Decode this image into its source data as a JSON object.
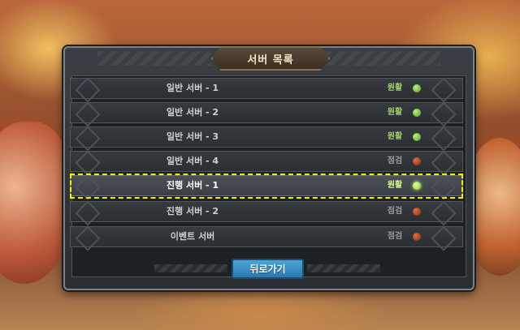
{
  "dialog": {
    "title": "서버 목록",
    "back_label": "뒤로가기"
  },
  "servers": [
    {
      "name": "일반 서버 - 1",
      "status": "원활",
      "state": "ok"
    },
    {
      "name": "일반 서버 - 2",
      "status": "원활",
      "state": "ok"
    },
    {
      "name": "일반 서버 - 3",
      "status": "원활",
      "state": "ok"
    },
    {
      "name": "일반 서버 - 4",
      "status": "점검",
      "state": "maintenance"
    },
    {
      "name": "진행 서버 - 1",
      "status": "원활",
      "state": "ok",
      "selected": true
    },
    {
      "name": "진행 서버 - 2",
      "status": "점검",
      "state": "maintenance"
    },
    {
      "name": "이벤트 서버",
      "status": "점검",
      "state": "maintenance"
    }
  ],
  "colors": {
    "ok": "#7ccf3f",
    "maintenance": "#c8441f",
    "selection": "#f0f000",
    "button": "#3a90c8"
  }
}
